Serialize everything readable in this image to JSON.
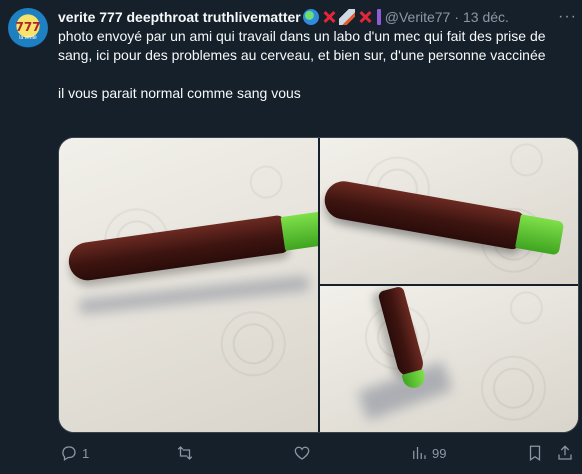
{
  "tweet": {
    "display_name": "verite 777 deepthroat truthlivematter",
    "handle": "@Verite77",
    "separator": "·",
    "date": "13 déc.",
    "text": "photo envoyé par un ami qui travail dans un labo d'un mec qui fait des prise de sang, ici pour des problemes au cerveau, et bien sur, d'une personne vaccinée\n\nil vous parait normal comme sang vous",
    "avatar_text": "777",
    "avatar_subtext": "la vérité"
  },
  "actions": {
    "reply_count": "1",
    "retweet_count": "",
    "like_count": "",
    "views_count": "99"
  },
  "icons": [
    "globe-icon",
    "red-x-icon",
    "rocket-icon",
    "red-x-icon",
    "purple-bar-icon",
    "more-icon",
    "reply-icon",
    "retweet-icon",
    "like-icon",
    "views-icon",
    "bookmark-icon",
    "share-icon"
  ]
}
